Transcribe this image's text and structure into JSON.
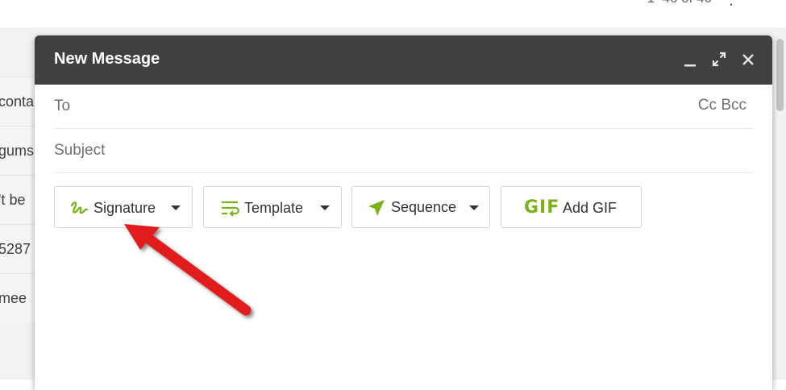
{
  "background": {
    "pager": "1–46 of 46",
    "kebab_icon": "more-vert-icon",
    "rows": [
      "conta",
      "gums",
      "'t be",
      "5287",
      "mee"
    ]
  },
  "compose": {
    "title": "New Message",
    "header_icons": [
      "minimize-icon",
      "expand-icon",
      "close-icon"
    ],
    "to_placeholder": "To",
    "cc_label": "Cc",
    "bcc_label": "Bcc",
    "subject_placeholder": "Subject",
    "toolbar": {
      "signature_label": "Signature",
      "template_label": "Template",
      "sequence_label": "Sequence",
      "gif_glyph": "GIF",
      "add_gif_label": "Add GIF"
    },
    "accent_color": "#7ab317",
    "annotation_color": "#e11b1b"
  }
}
